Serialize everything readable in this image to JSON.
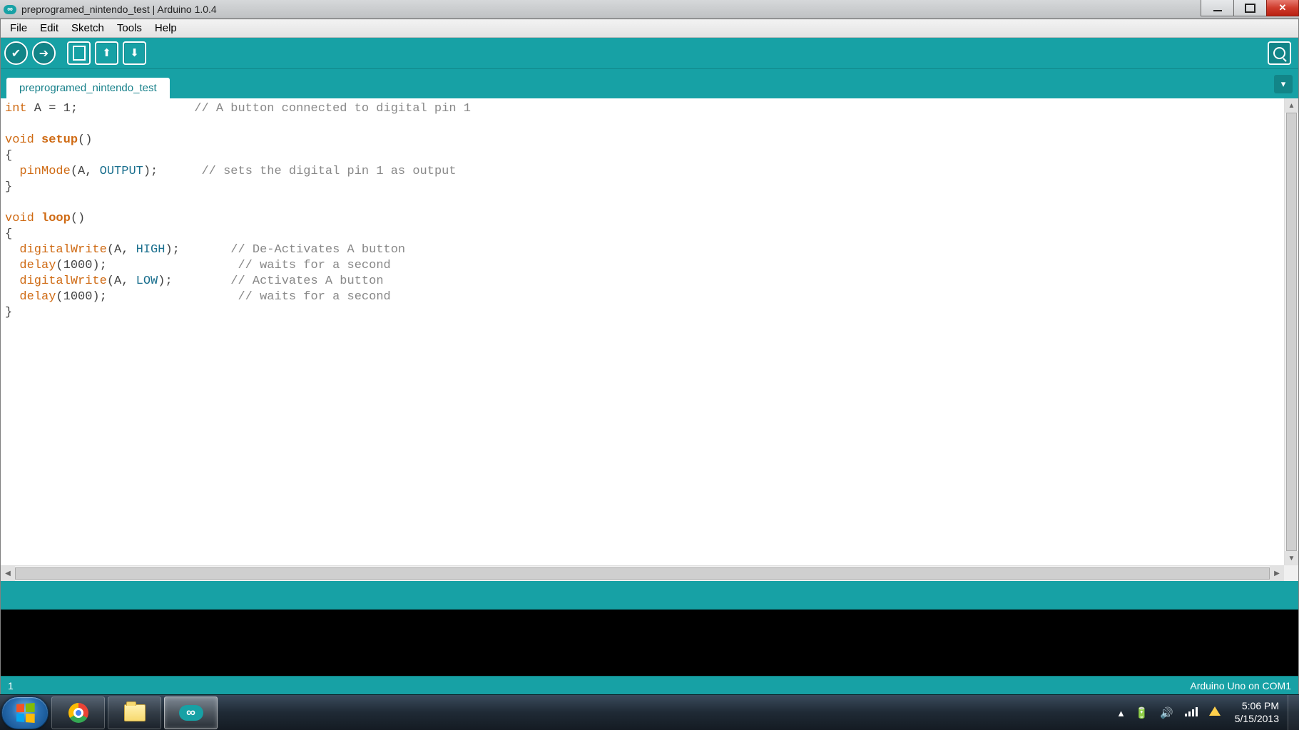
{
  "window": {
    "title": "preprogramed_nintendo_test | Arduino 1.0.4"
  },
  "menu": {
    "file": "File",
    "edit": "Edit",
    "sketch": "Sketch",
    "tools": "Tools",
    "help": "Help"
  },
  "tabs": {
    "active": "preprogramed_nintendo_test"
  },
  "code": {
    "l1_kw": "int",
    "l1_rest": " A = 1;",
    "l1_cmt": "// A button connected to digital pin 1",
    "l3_kw": "void",
    "l3_fn": "setup",
    "l3_rest": "()",
    "l4": "{",
    "l5_fn": "pinMode",
    "l5_paren_o": "(A, ",
    "l5_const": "OUTPUT",
    "l5_paren_c": ");",
    "l5_cmt": "// sets the digital pin 1 as output",
    "l6": "}",
    "l8_kw": "void",
    "l8_fn": "loop",
    "l8_rest": "()",
    "l9": "{",
    "l10_fn": "digitalWrite",
    "l10_args_o": "(A, ",
    "l10_const": "HIGH",
    "l10_args_c": ");",
    "l10_cmt": "// De-Activates A button",
    "l11_fn": "delay",
    "l11_args": "(1000);",
    "l11_cmt": "// waits for a second",
    "l12_fn": "digitalWrite",
    "l12_args_o": "(A, ",
    "l12_const": "LOW",
    "l12_args_c": ");",
    "l12_cmt": "// Activates A button",
    "l13_fn": "delay",
    "l13_args": "(1000);",
    "l13_cmt": "// waits for a second",
    "l14": "}"
  },
  "status": {
    "left": "1",
    "right": "Arduino Uno on COM1"
  },
  "tray": {
    "time": "5:06 PM",
    "date": "5/15/2013"
  }
}
